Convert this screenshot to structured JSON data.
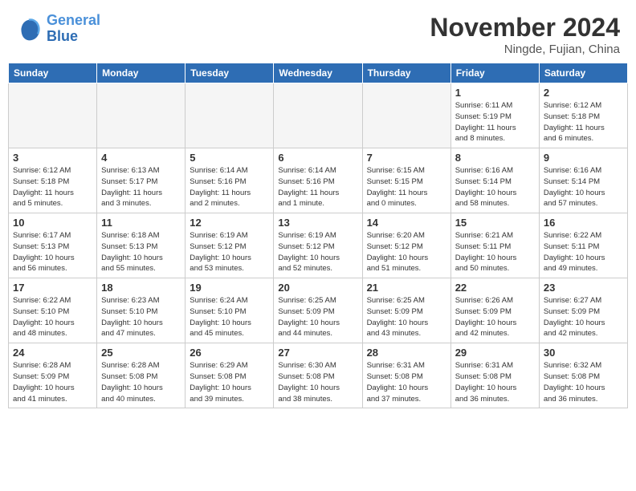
{
  "header": {
    "logo_line1": "General",
    "logo_line2": "Blue",
    "month_title": "November 2024",
    "location": "Ningde, Fujian, China"
  },
  "weekdays": [
    "Sunday",
    "Monday",
    "Tuesday",
    "Wednesday",
    "Thursday",
    "Friday",
    "Saturday"
  ],
  "weeks": [
    [
      {
        "day": "",
        "info": "",
        "empty": true
      },
      {
        "day": "",
        "info": "",
        "empty": true
      },
      {
        "day": "",
        "info": "",
        "empty": true
      },
      {
        "day": "",
        "info": "",
        "empty": true
      },
      {
        "day": "",
        "info": "",
        "empty": true
      },
      {
        "day": "1",
        "info": "Sunrise: 6:11 AM\nSunset: 5:19 PM\nDaylight: 11 hours\nand 8 minutes.",
        "empty": false
      },
      {
        "day": "2",
        "info": "Sunrise: 6:12 AM\nSunset: 5:18 PM\nDaylight: 11 hours\nand 6 minutes.",
        "empty": false
      }
    ],
    [
      {
        "day": "3",
        "info": "Sunrise: 6:12 AM\nSunset: 5:18 PM\nDaylight: 11 hours\nand 5 minutes.",
        "empty": false
      },
      {
        "day": "4",
        "info": "Sunrise: 6:13 AM\nSunset: 5:17 PM\nDaylight: 11 hours\nand 3 minutes.",
        "empty": false
      },
      {
        "day": "5",
        "info": "Sunrise: 6:14 AM\nSunset: 5:16 PM\nDaylight: 11 hours\nand 2 minutes.",
        "empty": false
      },
      {
        "day": "6",
        "info": "Sunrise: 6:14 AM\nSunset: 5:16 PM\nDaylight: 11 hours\nand 1 minute.",
        "empty": false
      },
      {
        "day": "7",
        "info": "Sunrise: 6:15 AM\nSunset: 5:15 PM\nDaylight: 11 hours\nand 0 minutes.",
        "empty": false
      },
      {
        "day": "8",
        "info": "Sunrise: 6:16 AM\nSunset: 5:14 PM\nDaylight: 10 hours\nand 58 minutes.",
        "empty": false
      },
      {
        "day": "9",
        "info": "Sunrise: 6:16 AM\nSunset: 5:14 PM\nDaylight: 10 hours\nand 57 minutes.",
        "empty": false
      }
    ],
    [
      {
        "day": "10",
        "info": "Sunrise: 6:17 AM\nSunset: 5:13 PM\nDaylight: 10 hours\nand 56 minutes.",
        "empty": false
      },
      {
        "day": "11",
        "info": "Sunrise: 6:18 AM\nSunset: 5:13 PM\nDaylight: 10 hours\nand 55 minutes.",
        "empty": false
      },
      {
        "day": "12",
        "info": "Sunrise: 6:19 AM\nSunset: 5:12 PM\nDaylight: 10 hours\nand 53 minutes.",
        "empty": false
      },
      {
        "day": "13",
        "info": "Sunrise: 6:19 AM\nSunset: 5:12 PM\nDaylight: 10 hours\nand 52 minutes.",
        "empty": false
      },
      {
        "day": "14",
        "info": "Sunrise: 6:20 AM\nSunset: 5:12 PM\nDaylight: 10 hours\nand 51 minutes.",
        "empty": false
      },
      {
        "day": "15",
        "info": "Sunrise: 6:21 AM\nSunset: 5:11 PM\nDaylight: 10 hours\nand 50 minutes.",
        "empty": false
      },
      {
        "day": "16",
        "info": "Sunrise: 6:22 AM\nSunset: 5:11 PM\nDaylight: 10 hours\nand 49 minutes.",
        "empty": false
      }
    ],
    [
      {
        "day": "17",
        "info": "Sunrise: 6:22 AM\nSunset: 5:10 PM\nDaylight: 10 hours\nand 48 minutes.",
        "empty": false
      },
      {
        "day": "18",
        "info": "Sunrise: 6:23 AM\nSunset: 5:10 PM\nDaylight: 10 hours\nand 47 minutes.",
        "empty": false
      },
      {
        "day": "19",
        "info": "Sunrise: 6:24 AM\nSunset: 5:10 PM\nDaylight: 10 hours\nand 45 minutes.",
        "empty": false
      },
      {
        "day": "20",
        "info": "Sunrise: 6:25 AM\nSunset: 5:09 PM\nDaylight: 10 hours\nand 44 minutes.",
        "empty": false
      },
      {
        "day": "21",
        "info": "Sunrise: 6:25 AM\nSunset: 5:09 PM\nDaylight: 10 hours\nand 43 minutes.",
        "empty": false
      },
      {
        "day": "22",
        "info": "Sunrise: 6:26 AM\nSunset: 5:09 PM\nDaylight: 10 hours\nand 42 minutes.",
        "empty": false
      },
      {
        "day": "23",
        "info": "Sunrise: 6:27 AM\nSunset: 5:09 PM\nDaylight: 10 hours\nand 42 minutes.",
        "empty": false
      }
    ],
    [
      {
        "day": "24",
        "info": "Sunrise: 6:28 AM\nSunset: 5:09 PM\nDaylight: 10 hours\nand 41 minutes.",
        "empty": false
      },
      {
        "day": "25",
        "info": "Sunrise: 6:28 AM\nSunset: 5:08 PM\nDaylight: 10 hours\nand 40 minutes.",
        "empty": false
      },
      {
        "day": "26",
        "info": "Sunrise: 6:29 AM\nSunset: 5:08 PM\nDaylight: 10 hours\nand 39 minutes.",
        "empty": false
      },
      {
        "day": "27",
        "info": "Sunrise: 6:30 AM\nSunset: 5:08 PM\nDaylight: 10 hours\nand 38 minutes.",
        "empty": false
      },
      {
        "day": "28",
        "info": "Sunrise: 6:31 AM\nSunset: 5:08 PM\nDaylight: 10 hours\nand 37 minutes.",
        "empty": false
      },
      {
        "day": "29",
        "info": "Sunrise: 6:31 AM\nSunset: 5:08 PM\nDaylight: 10 hours\nand 36 minutes.",
        "empty": false
      },
      {
        "day": "30",
        "info": "Sunrise: 6:32 AM\nSunset: 5:08 PM\nDaylight: 10 hours\nand 36 minutes.",
        "empty": false
      }
    ]
  ]
}
